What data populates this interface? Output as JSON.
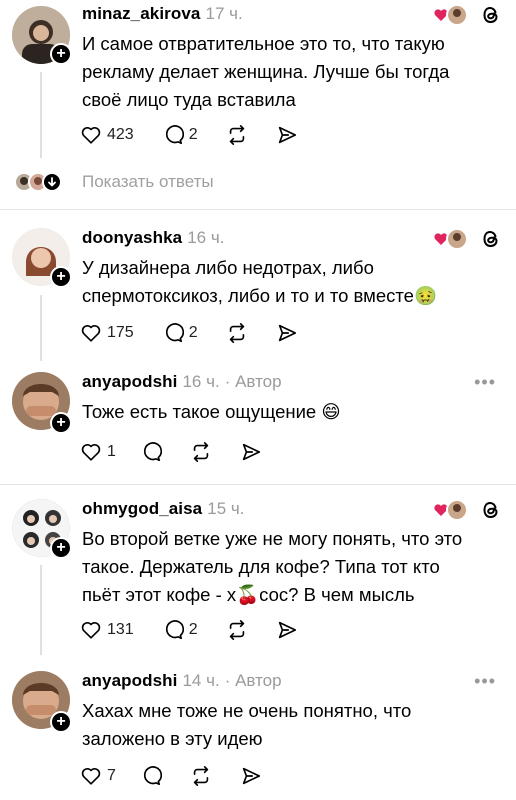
{
  "comments": [
    {
      "username": "minaz_akirova",
      "time": "17 ч.",
      "author_tag": "",
      "lines": [
        "И самое отвратительное это то, что такую",
        "рекламу делает женщина. Лучше бы тогда",
        "своё лицо туда вставила"
      ],
      "likes": "423",
      "replies": "2"
    },
    {
      "username": "doonyashka",
      "time": "16 ч.",
      "author_tag": "",
      "lines": [
        "У дизайнера либо недотрах, либо",
        "спермотоксикоз, либо и то и то вместе🤢"
      ],
      "likes": "175",
      "replies": "2"
    },
    {
      "username": "anyapodshi",
      "time": "16 ч.",
      "author_tag": "· Автор",
      "lines": [
        "Тоже есть такое ощущение 😄"
      ],
      "likes": "1",
      "replies": ""
    },
    {
      "username": "ohmygod_aisa",
      "time": "15 ч.",
      "author_tag": "",
      "lines": [
        "Во второй ветке уже не могу понять, что это",
        "такое. Держатель для кофе? Типа тот кто",
        "пьёт этот кофе - х🍒сос? В чем мысль"
      ],
      "likes": "131",
      "replies": "2"
    },
    {
      "username": "anyapodshi",
      "time": "14 ч.",
      "author_tag": "· Автор",
      "lines": [
        "Хахах мне тоже не очень понятно, что",
        "заложено в эту идею"
      ],
      "likes": "7",
      "replies": ""
    }
  ],
  "show_replies_label": "Показать ответы",
  "icons": {
    "like": "heart-icon",
    "reply": "comment-bubble-icon",
    "repost": "repost-icon",
    "share": "send-icon",
    "threads": "threads-logo-icon",
    "more": "more-dots-icon"
  },
  "more_dots": "•••",
  "plus_glyph": "+"
}
